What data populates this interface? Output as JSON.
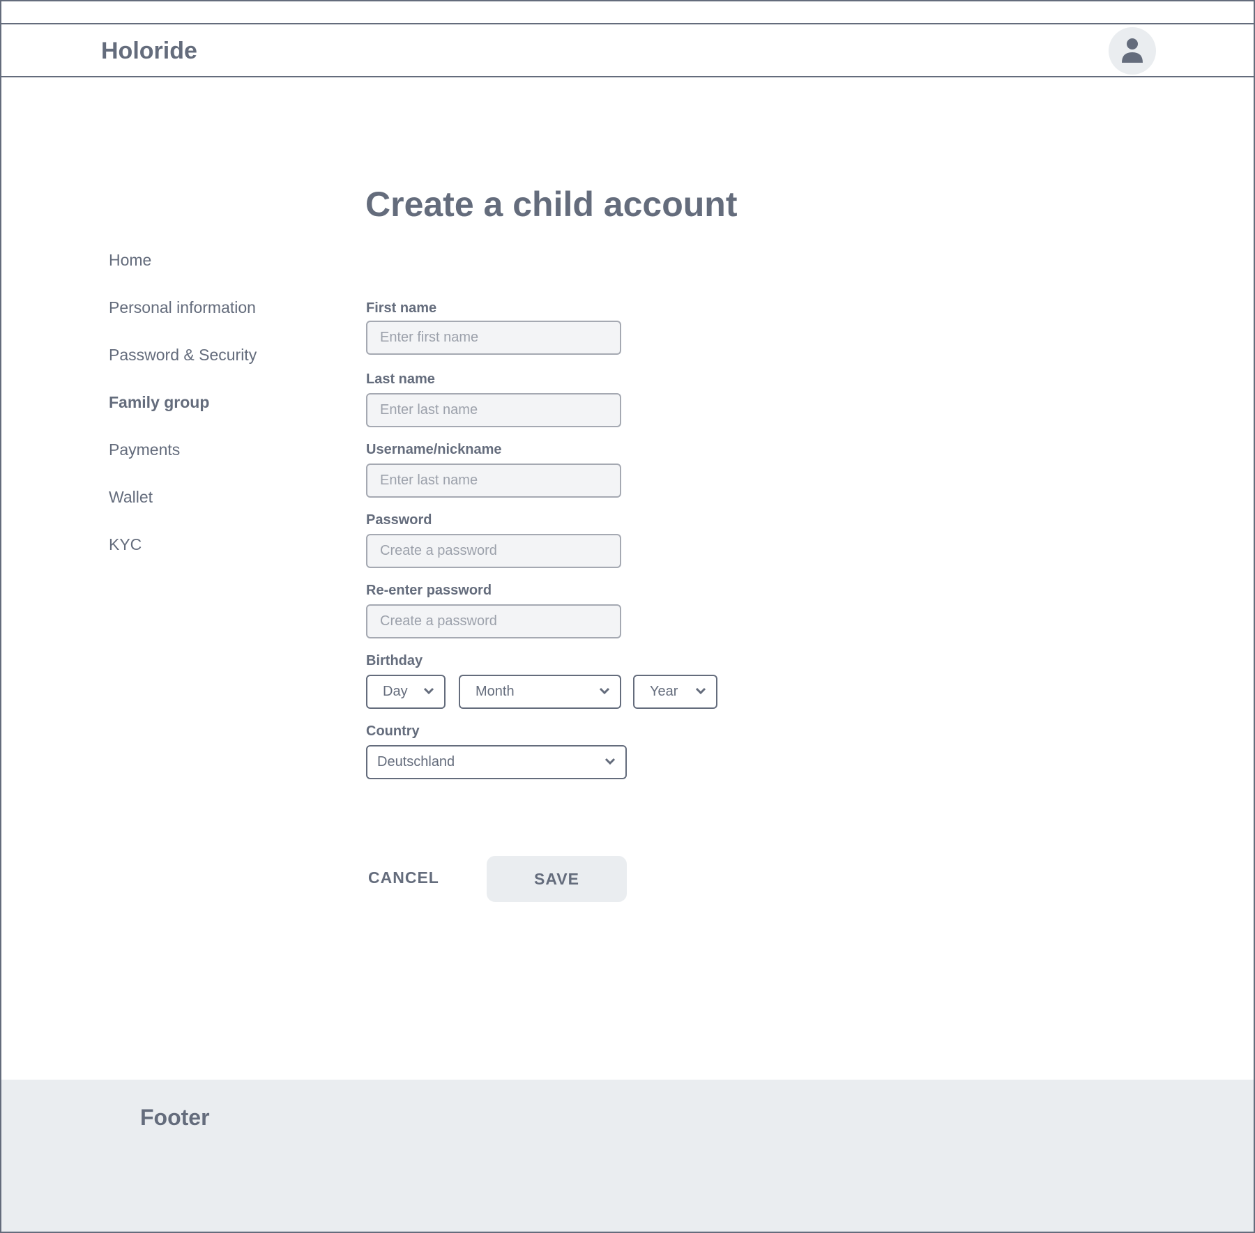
{
  "header": {
    "brand": "Holoride",
    "avatar_icon": "user-icon"
  },
  "sidebar": {
    "items": [
      {
        "label": "Home"
      },
      {
        "label": "Personal information"
      },
      {
        "label": "Password & Security"
      },
      {
        "label": "Family group",
        "active": true
      },
      {
        "label": "Payments"
      },
      {
        "label": "Wallet"
      },
      {
        "label": "KYC"
      }
    ]
  },
  "main": {
    "title": "Create a child account",
    "fields": [
      {
        "label": "First name",
        "placeholder": "Enter first name"
      },
      {
        "label": "Last name",
        "placeholder": "Enter last name"
      },
      {
        "label": "Username/nickname",
        "placeholder": "Enter last name"
      },
      {
        "label": "Password",
        "placeholder": "Create a password"
      },
      {
        "label": "Re-enter password",
        "placeholder": "Create a password"
      }
    ],
    "birthday": {
      "label": "Birthday",
      "day": "Day",
      "month": "Month",
      "year": "Year"
    },
    "country": {
      "label": "Country",
      "value": "Deutschland"
    },
    "cancel_label": "CANCEL",
    "save_label": "SAVE"
  },
  "footer": {
    "label": "Footer"
  },
  "colors": {
    "text": "#646c7c",
    "input_bg": "#f3f4f6",
    "footer_bg": "#eaedf0"
  }
}
